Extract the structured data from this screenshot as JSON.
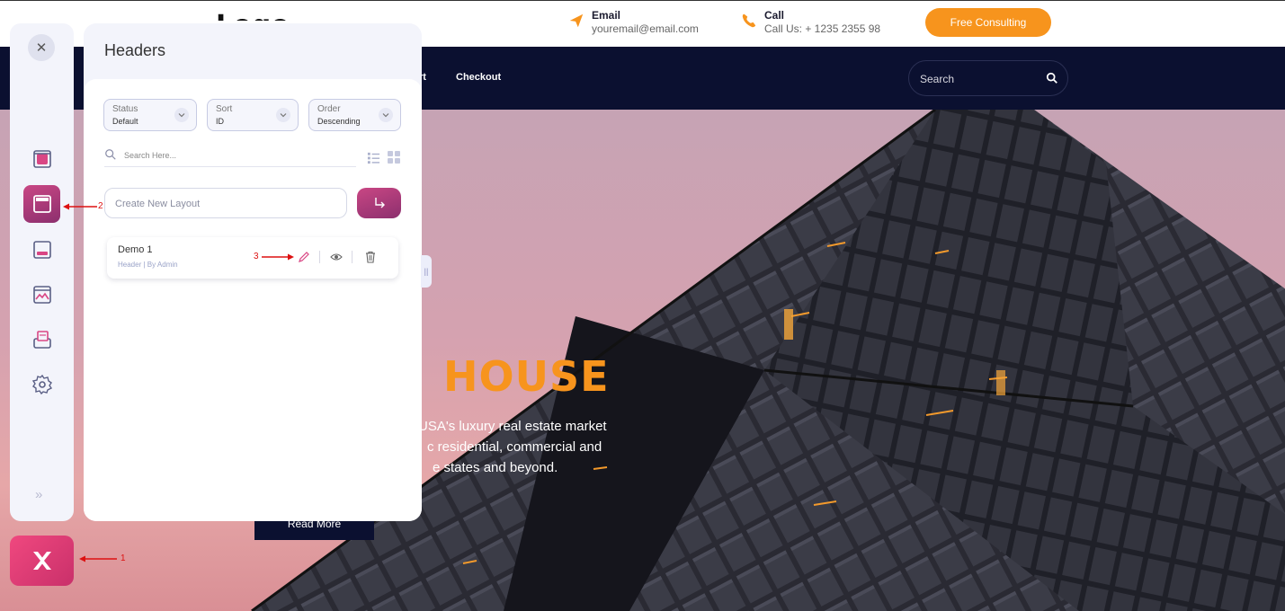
{
  "site": {
    "logo_text": "Logo",
    "email_label": "Email",
    "email_value": "youremail@email.com",
    "call_label": "Call",
    "call_value": "Call Us: + 1235 2355 98",
    "cta_label": "Free Consulting",
    "nav_partial": "rt",
    "nav_checkout": "Checkout",
    "search_placeholder": "Search",
    "accent_color": "#f7941d",
    "nav_bg_color": "#0b1030"
  },
  "hero": {
    "title_partial": "HOUSE",
    "line1": "USA's luxury real estate market",
    "line2": "c residential, commercial and",
    "line3": "e states and beyond.",
    "button_label": "Read More"
  },
  "builder": {
    "rail_icons": [
      "layout-icon",
      "header-icon",
      "footer-icon",
      "gallery-icon",
      "template-icon",
      "settings-icon"
    ],
    "active_icon": "header-icon",
    "brand_gradient": [
      "#c94784",
      "#8c2f6e"
    ],
    "panel": {
      "title": "Headers",
      "filters": [
        {
          "label": "Status",
          "value": "Default"
        },
        {
          "label": "Sort",
          "value": "ID"
        },
        {
          "label": "Order",
          "value": "Descending"
        }
      ],
      "search_placeholder": "Search Here...",
      "new_layout_placeholder": "Create New Layout",
      "items": [
        {
          "name": "Demo 1",
          "type": "Header",
          "author": "By Admin"
        }
      ]
    }
  },
  "annotations": {
    "step1": "1",
    "step2": "2",
    "step3": "3"
  }
}
